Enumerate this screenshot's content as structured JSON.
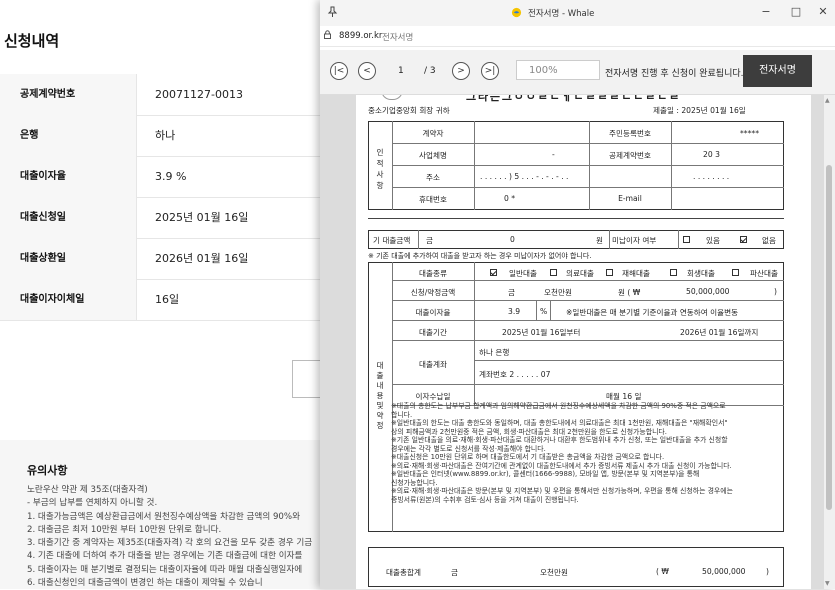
{
  "background": {
    "title": "신청내역",
    "rows": [
      {
        "label": "공제계약번호",
        "value": "20071127-0013"
      },
      {
        "label": "은행",
        "value": "하나"
      },
      {
        "label": "대출이자율",
        "value": "3.9 %"
      },
      {
        "label": "대출신청일",
        "value": "2025년 01월 16일"
      },
      {
        "label": "대출상환일",
        "value": "2026년 01월 16일"
      },
      {
        "label": "대출이자이체일",
        "value": "16일"
      }
    ],
    "notice": {
      "title": "유의사항",
      "lines": [
        "노란우산 약관 제 35조(대출자격)",
        "- 부금의 납부를 연체하지 아니할 것.",
        "1. 대출가능금액은 예상환급금에서 원천징수예상액을 차감한 금액의 90%와",
        "2. 대출금은 최저 10만원 부터 10만원 단위로 합니다.",
        "3. 대출기간 중 계약자는 제35조(대출자격) 각 호의 요건을 모두 갖춘 경우 기금",
        "4. 기존 대출에 더하여 추가 대출을 받는 경우에는 기존 대출금에 대한 이자를",
        "5. 대출이자는 매 분기별로 결정되는 대출이자율에 따라 매월 대출실행일자에",
        "6. 대출신청인의 대출금액이 변경인 하는 대출이 제약될 수 있습니"
      ]
    }
  },
  "window": {
    "title": "전자서명 - Whale",
    "url_domain": "8899.or.kr",
    "url_page": "전자서명",
    "controls": {
      "minimize": "−",
      "maximize": "□",
      "close": "✕"
    }
  },
  "toolbar": {
    "first": "|<",
    "prev": "<",
    "page_current": "1",
    "page_total": "/ 3",
    "next": ">",
    "last": ">|",
    "zoom": "100%",
    "status": "전자서명 진행 후 신청이 완료됩니다.",
    "sign_button": "전자서명"
  },
  "doc": {
    "header_title": "그 라 는 그 ㅇ ㅇ ㄹ ㄴ ㅔ ㄷ ㄹ ㄹ ㄹ ㄴ ㄴ ㄹ ㄷ ㄹ",
    "recipient": "중소기업중앙회 회장  귀하",
    "submit_date": "제출일 : 2025년 01월 16일",
    "person": {
      "side_label": "인 적 사 항",
      "r1_label": "계약자",
      "r1_mid_label": "주민등록번호",
      "r1_mid_value": "*****",
      "r2_label": "사업체명",
      "r2_value": "-",
      "r2_mid_label": "공제계약번호",
      "r2_mid_value": "20        3",
      "r3_label": "주소",
      "r3_value": ". . . . . . ) 5 . . . - . - . - . .",
      "r3_right": ". . . . . . . .",
      "r4_label": "휴대번호",
      "r4_value": "0             *",
      "r4_mid_label": "E-mail"
    },
    "existing": {
      "label": "기 대출금액",
      "prefix": "금",
      "amount": "0",
      "unit": "원",
      "unpaid_label": "미납이자 여부",
      "opt_yes": "있음",
      "opt_no": "없음",
      "note": "※ 기존 대출에 추가하여 대출을 받고자 하는 경우 미납이자가 없어야 합니다."
    },
    "loan": {
      "side_label": "대 출 내 용  및  약 정",
      "type_label": "대출종류",
      "types": [
        "일반대출",
        "의료대출",
        "재해대출",
        "회생대출",
        "파산대출"
      ],
      "amount_label": "신청/약정금액",
      "amount_prefix": "금",
      "amount_korean": "오천만원",
      "amount_unit": "원 ( ₩",
      "amount_number": "50,000,000",
      "amount_close": ")",
      "rate_label": "대출이자율",
      "rate_value": "3.9",
      "rate_unit": "%",
      "rate_note": "※일반대출은 매 분기별 기준이율과 연동하여 이율변동",
      "period_label": "대출기간",
      "period_from": "2025년 01월 16일부터",
      "period_to": "2026년 01월 16일까지",
      "account_label": "대출계좌",
      "account_bank": "하나 은행",
      "account_number": "계좌번호 2                  . . . . . 07",
      "pay_label": "이자수납일",
      "pay_value": "매월 16 일"
    },
    "notes": [
      "※대출의 총한도는 납부부금 합계액과 임의해약환급금에서 원천징수예상세액을 차감한 금액의 90%중 적은 금액으로",
      "  합니다.",
      "※일반대출의 한도는 대출 총한도와 동일하며, 대출 총한도내에서 의료대출은 최대 1천만원, 재해대출은 \"재해확인서\"",
      "  상의 피해금액과 2천만원중 적은 금액, 회생·파산대출은 최대 2천만원을 한도로 신청가능합니다.",
      "※기존 일반대출을 의료·재해·회생·파산대출로 대환하거나 대환후 한도범위내 추가 신청, 또는 일반대출을 추가 신청할",
      "  경우에는 각각 별도로 신청서를 작성·제출해야 합니다.",
      "※대출신청은 10만원 단위로 하며 대출한도에서 기 대출받은 총금액을 차감한 금액으로 합니다.",
      "※의료·재해·회생·파산대출은 잔여기간에 관계없이 대출한도내에서 추가 증빙서류 제출시 추가 대출 신청이 가능합니다.",
      "※일반대출은 인터넷(www.8899.or.kr), 콜센터(1666-9988), 모바일 앱, 방문(본부 및 지역본부)을 통해",
      "  신청가능합니다.",
      "※의료·재해·회생·파산대출은 방문(본부 및 지역본부) 및 우편을 통해서만 신청가능하며, 우편을 통해 신청하는 경우에는",
      "  증빙서류(원본)의 수취후 검토·심사 등을 거쳐 대출이 진행됩니다."
    ],
    "total": {
      "label": "대출총합계",
      "prefix": "금",
      "korean": "오천만원",
      "won": "( ₩",
      "number": "50,000,000",
      "close": ")"
    }
  },
  "colors": {
    "sign_button": "#3d3d3d",
    "toolbar": "#f2f2f2",
    "doc_background": "#dcdcdc"
  }
}
